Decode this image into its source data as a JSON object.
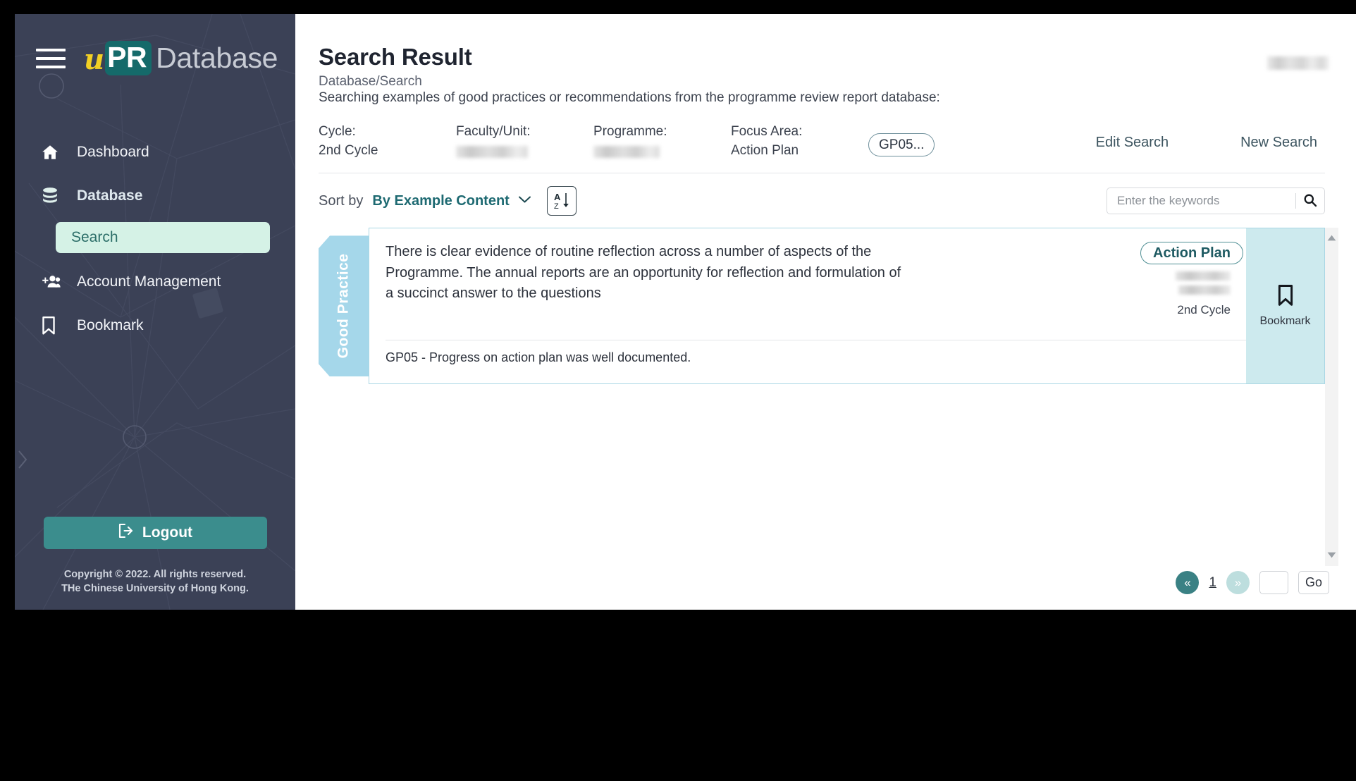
{
  "brand": {
    "mark_u": "u",
    "mark_pr": "PR",
    "mark_db": "Database",
    "hamburger_icon": "hamburger-menu-icon"
  },
  "sidebar": {
    "items": [
      {
        "label": "Dashboard",
        "icon": "home-icon",
        "active": false
      },
      {
        "label": "Database",
        "icon": "database-icon",
        "active": true
      },
      {
        "label": "Account Management",
        "icon": "add-user-icon",
        "active": false
      },
      {
        "label": "Bookmark",
        "icon": "bookmark-icon",
        "active": false
      }
    ],
    "sub_item": {
      "label": "Search",
      "icon": "search-sub-icon"
    },
    "logout": {
      "label": "Logout",
      "icon": "logout-icon",
      "color": "#3b8d8d"
    },
    "copyright_line1": "Copyright © 2022. All rights reserved.",
    "copyright_line2": "THe Chinese University of Hong Kong."
  },
  "header": {
    "title": "Search Result",
    "breadcrumb": "Database/Search",
    "subtitle": "Searching examples of good practices or recommendations from the programme review report database:",
    "user_badge": "",
    "filters": [
      {
        "label": "Cycle:",
        "value": "2nd Cycle",
        "redacted": false
      },
      {
        "label": "Faculty/Unit:",
        "value": "",
        "redacted": true
      },
      {
        "label": "Programme:",
        "value": "",
        "redacted": true
      },
      {
        "label": "Focus Area:",
        "value": "Action Plan",
        "redacted": false
      }
    ],
    "chip": "GP05...",
    "edit_search": "Edit Search",
    "new_search": "New Search"
  },
  "toolbar": {
    "sort_label": "Sort by",
    "sort_value": "By Example Content",
    "chevron_icon": "chevron-down-icon",
    "az_sort_icon": "sort-a-z-descending-icon",
    "az_top": "A",
    "az_bottom": "Z",
    "search_placeholder": "Enter the keywords",
    "search_value": "",
    "search_icon": "magnifier-icon"
  },
  "results": [
    {
      "ribbon": "Good Practice",
      "text": "There is clear evidence of routine reflection across a number of aspects of the Programme. The annual reports are an opportunity for reflection and formulation of a succinct answer to the questions",
      "badge": "Action Plan",
      "meta_redacted_1": "",
      "meta_redacted_2": "",
      "cycle": "2nd Cycle",
      "footer": "GP05 - Progress on action plan was well documented.",
      "bookmark_label": "Bookmark",
      "bookmark_icon": "bookmark-outline-icon"
    }
  ],
  "scrollbar": {
    "up_icon": "triangle-up-icon",
    "down_icon": "triangle-down-icon"
  },
  "pagination": {
    "prev": "«",
    "next": "»",
    "current_page": "1",
    "jump_value": "",
    "go_label": "Go"
  },
  "colors": {
    "sidebar_bg": "#3b4156",
    "accent_teal": "#1e6a72",
    "ribbon_blue": "#a5d7ea",
    "bookmark_bg": "#cdeaee",
    "logo_yellow": "#f2d024",
    "logo_teal": "#156a6a",
    "search_pill": "#d5f2e6"
  }
}
